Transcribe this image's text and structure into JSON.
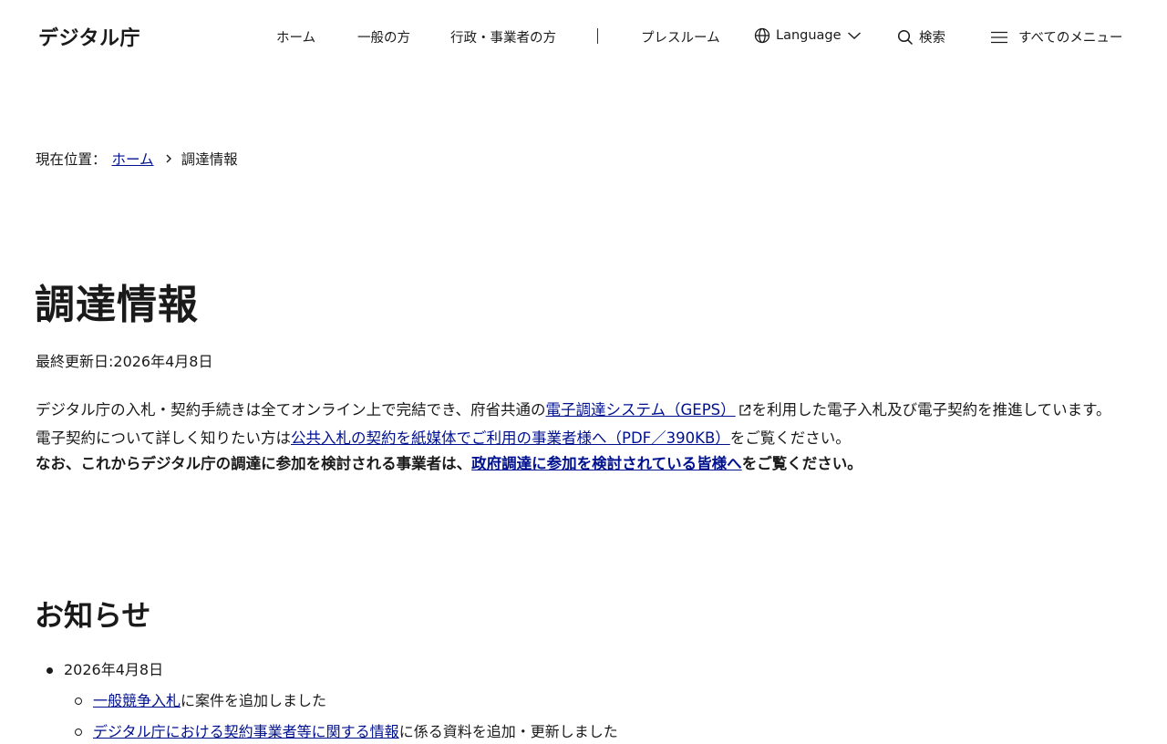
{
  "header": {
    "logo": "デジタル庁",
    "nav": {
      "home": "ホーム",
      "general": "一般の方",
      "business": "行政・事業者の方",
      "press": "プレスルーム",
      "language": "Language",
      "search": "検索",
      "all_menu": "すべてのメニュー"
    }
  },
  "breadcrumb": {
    "prefix": "現在位置：",
    "home": "ホーム",
    "current": "調達情報"
  },
  "page": {
    "title": "調達情報",
    "updated": "最終更新日:2026年4月8日"
  },
  "intro": {
    "p1_before": "デジタル庁の入札・契約手続きは全てオンライン上で完結でき、府省共通の",
    "p1_link": "電子調達システム（GEPS）",
    "p1_after": "を利用した電子入札及び電子契約を推進しています。",
    "p2_before": "電子契約について詳しく知りたい方は",
    "p2_link": "公共入札の契約を紙媒体でご利用の事業者様へ（PDF／390KB）",
    "p2_after": "をご覧ください。",
    "p3_before": "なお、これからデジタル庁の調達に参加を検討される事業者は、",
    "p3_link": "政府調達に参加を検討されている皆様へ",
    "p3_after": "をご覧ください。"
  },
  "news": {
    "title": "お知らせ",
    "date": "2026年4月8日",
    "items": [
      {
        "link": "一般競争入札",
        "text": "に案件を追加しました"
      },
      {
        "link": "デジタル庁における契約事業者等に関する情報",
        "text": "に係る資料を追加・更新しました"
      }
    ]
  },
  "icons": {
    "globe": "globe-icon",
    "chevron": "chevron-down-icon",
    "search": "search-icon",
    "menu": "hamburger-icon",
    "external": "external-link-icon"
  },
  "colors": {
    "link": "#00118f",
    "text": "#1a1a1a"
  }
}
